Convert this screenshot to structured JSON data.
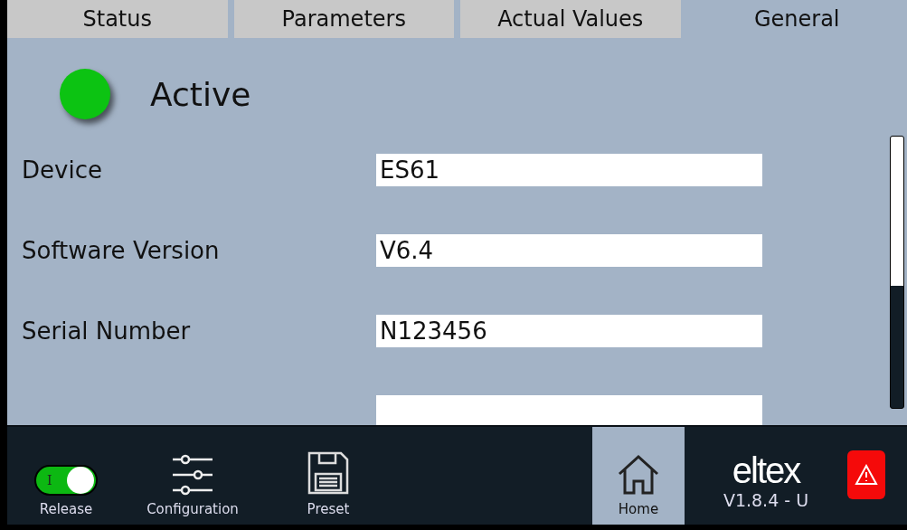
{
  "tabs": [
    {
      "label": "Status",
      "selected": false
    },
    {
      "label": "Parameters",
      "selected": false
    },
    {
      "label": "Actual Values",
      "selected": false
    },
    {
      "label": "General",
      "selected": true
    }
  ],
  "status": {
    "label": "Active",
    "on": true
  },
  "fields": [
    {
      "label": "Device",
      "value": "ES61"
    },
    {
      "label": "Software Version",
      "value": "V6.4"
    },
    {
      "label": "Serial Number",
      "value": "N123456"
    }
  ],
  "nav": [
    {
      "kind": "switch",
      "label": "Release",
      "on": true,
      "switch_text": "I",
      "selected": false
    },
    {
      "kind": "sliders",
      "label": "Configuration",
      "selected": false
    },
    {
      "kind": "save",
      "label": "Preset",
      "selected": false
    },
    {
      "kind": "spacer"
    },
    {
      "kind": "home",
      "label": "Home",
      "selected": true
    }
  ],
  "brand": {
    "logo": "eltex",
    "version": "V1.8.4 - U"
  }
}
